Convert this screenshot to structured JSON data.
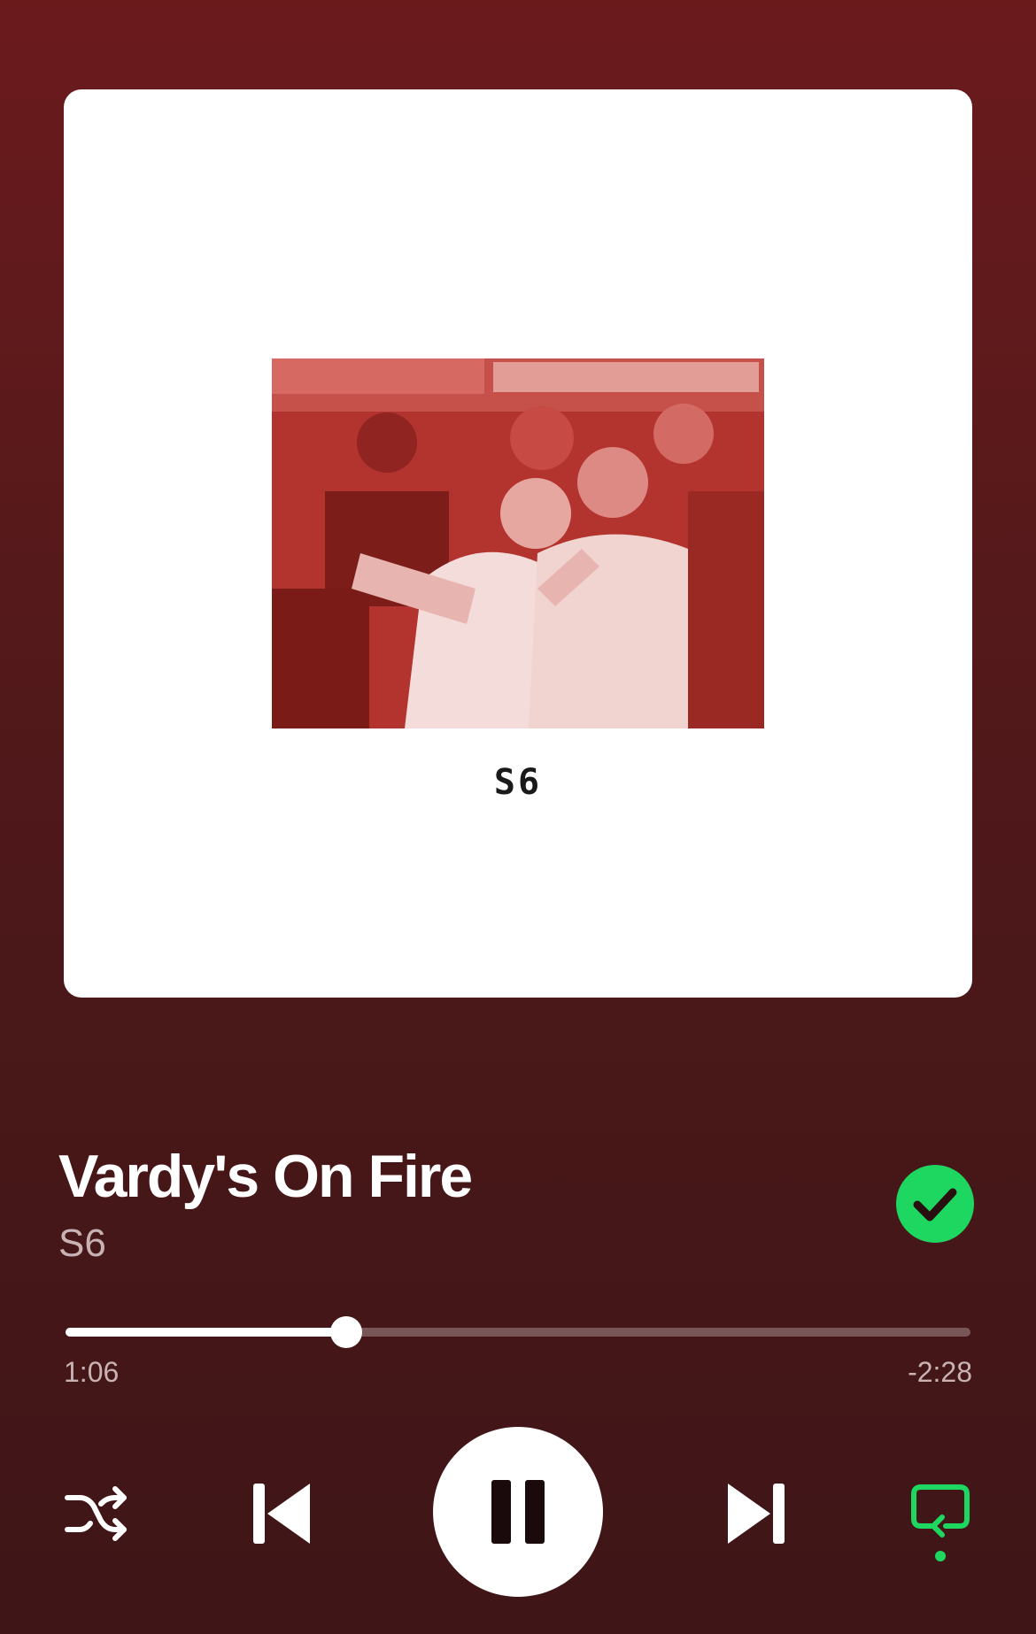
{
  "album_art": {
    "title": "VARDY'S ON FIRE",
    "artist": "S6"
  },
  "track": {
    "title": "Vardy's On Fire",
    "artist": "S6",
    "liked": true
  },
  "playback": {
    "elapsed": "1:06",
    "remaining": "-2:28",
    "progress": 0.31,
    "state": "playing"
  },
  "controls": {
    "shuffle_icon": "shuffle-icon",
    "previous_icon": "skip-previous-icon",
    "play_pause_icon": "pause-icon",
    "next_icon": "skip-next-icon",
    "repeat_icon": "repeat-icon",
    "repeat_active": true
  },
  "colors": {
    "accent": "#1ed760",
    "background_top": "#6b1a1c",
    "background_bottom": "#3f1517",
    "secondary_text": "#c9b2b3"
  }
}
